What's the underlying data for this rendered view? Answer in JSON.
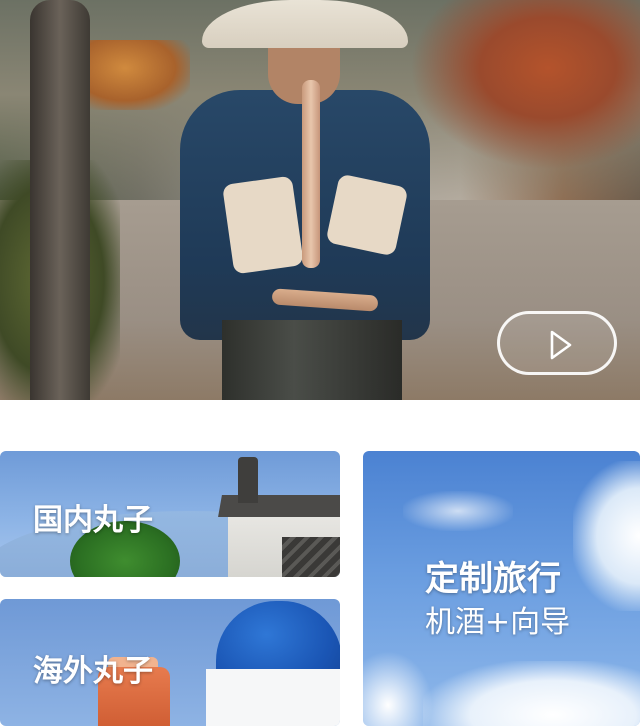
{
  "video": {
    "play_icon": "play-icon"
  },
  "cards": {
    "domestic": {
      "title": "国内丸子"
    },
    "overseas": {
      "title": "海外丸子"
    },
    "custom": {
      "title": "定制旅行",
      "subtitle": "机酒+向导"
    }
  }
}
